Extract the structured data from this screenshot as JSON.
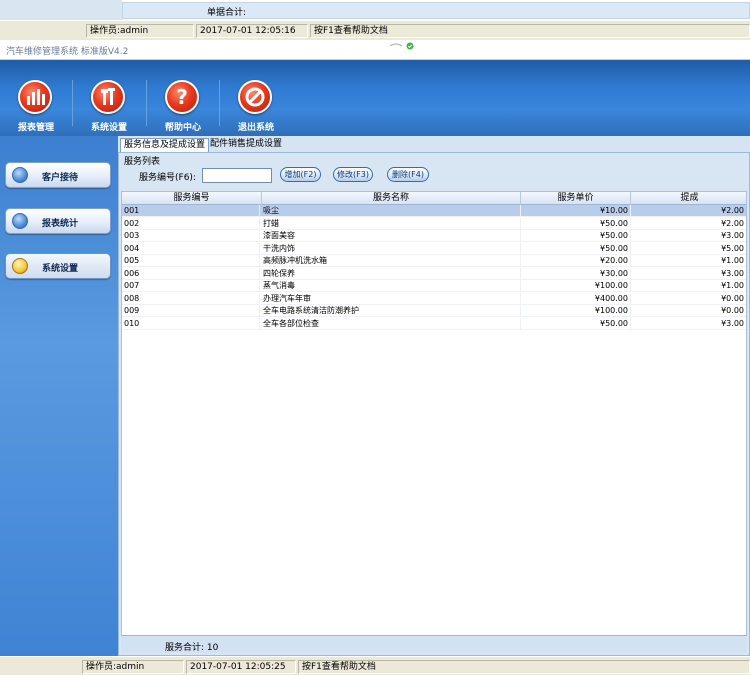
{
  "bg_window": {
    "summary_label": "单据合计:",
    "status": {
      "operator": "操作员:admin",
      "datetime": "2017-07-01 12:05:16",
      "help": "按F1查看帮助文档"
    }
  },
  "window": {
    "title": "汽车维修管理系统 标准版V4.2"
  },
  "toolbar": [
    {
      "label": "报表管理",
      "icon": "bar-chart-icon"
    },
    {
      "label": "系统设置",
      "icon": "tools-icon"
    },
    {
      "label": "帮助中心",
      "icon": "question-icon"
    },
    {
      "label": "退出系统",
      "icon": "exit-icon"
    }
  ],
  "sidebar": [
    {
      "label": "客户接待",
      "active": false
    },
    {
      "label": "报表统计",
      "active": false
    },
    {
      "label": "系统设置",
      "active": true
    }
  ],
  "tabs": [
    {
      "label": "服务信息及提成设置",
      "active": true
    },
    {
      "label": "配件销售提成设置",
      "active": false
    }
  ],
  "panel": {
    "group_label": "服务列表",
    "search_label": "服务编号(F6):",
    "search_value": "",
    "buttons": {
      "add": "增加(F2)",
      "edit": "修改(F3)",
      "delete": "删除(F4)"
    }
  },
  "grid": {
    "columns": [
      "服务编号",
      "服务名称",
      "服务单价",
      "提成"
    ],
    "rows": [
      {
        "code": "001",
        "name": "吸尘",
        "price": "¥10.00",
        "commission": "¥2.00"
      },
      {
        "code": "002",
        "name": "打蜡",
        "price": "¥50.00",
        "commission": "¥2.00"
      },
      {
        "code": "003",
        "name": "漆面美容",
        "price": "¥50.00",
        "commission": "¥3.00"
      },
      {
        "code": "004",
        "name": "干洗内饰",
        "price": "¥50.00",
        "commission": "¥5.00"
      },
      {
        "code": "005",
        "name": "高频脉冲机洗水箱",
        "price": "¥20.00",
        "commission": "¥1.00"
      },
      {
        "code": "006",
        "name": "四轮保养",
        "price": "¥30.00",
        "commission": "¥3.00"
      },
      {
        "code": "007",
        "name": "蒸气消毒",
        "price": "¥100.00",
        "commission": "¥1.00"
      },
      {
        "code": "008",
        "name": "办理汽车年审",
        "price": "¥400.00",
        "commission": "¥0.00"
      },
      {
        "code": "009",
        "name": "全车电路系统清洁防潮养护",
        "price": "¥100.00",
        "commission": "¥0.00"
      },
      {
        "code": "010",
        "name": "全车各部位检查",
        "price": "¥50.00",
        "commission": "¥3.00"
      }
    ],
    "selected_index": 0,
    "footer": "服务合计: 10"
  },
  "status": {
    "operator": "操作员:admin",
    "datetime": "2017-07-01 12:05:25",
    "help": "按F1查看帮助文档"
  },
  "colors": {
    "toolbar": "#2f7ad2",
    "sidebar": "#4a8bd8",
    "icon_red": "#e83a1f",
    "selection": "#b9cdea"
  }
}
